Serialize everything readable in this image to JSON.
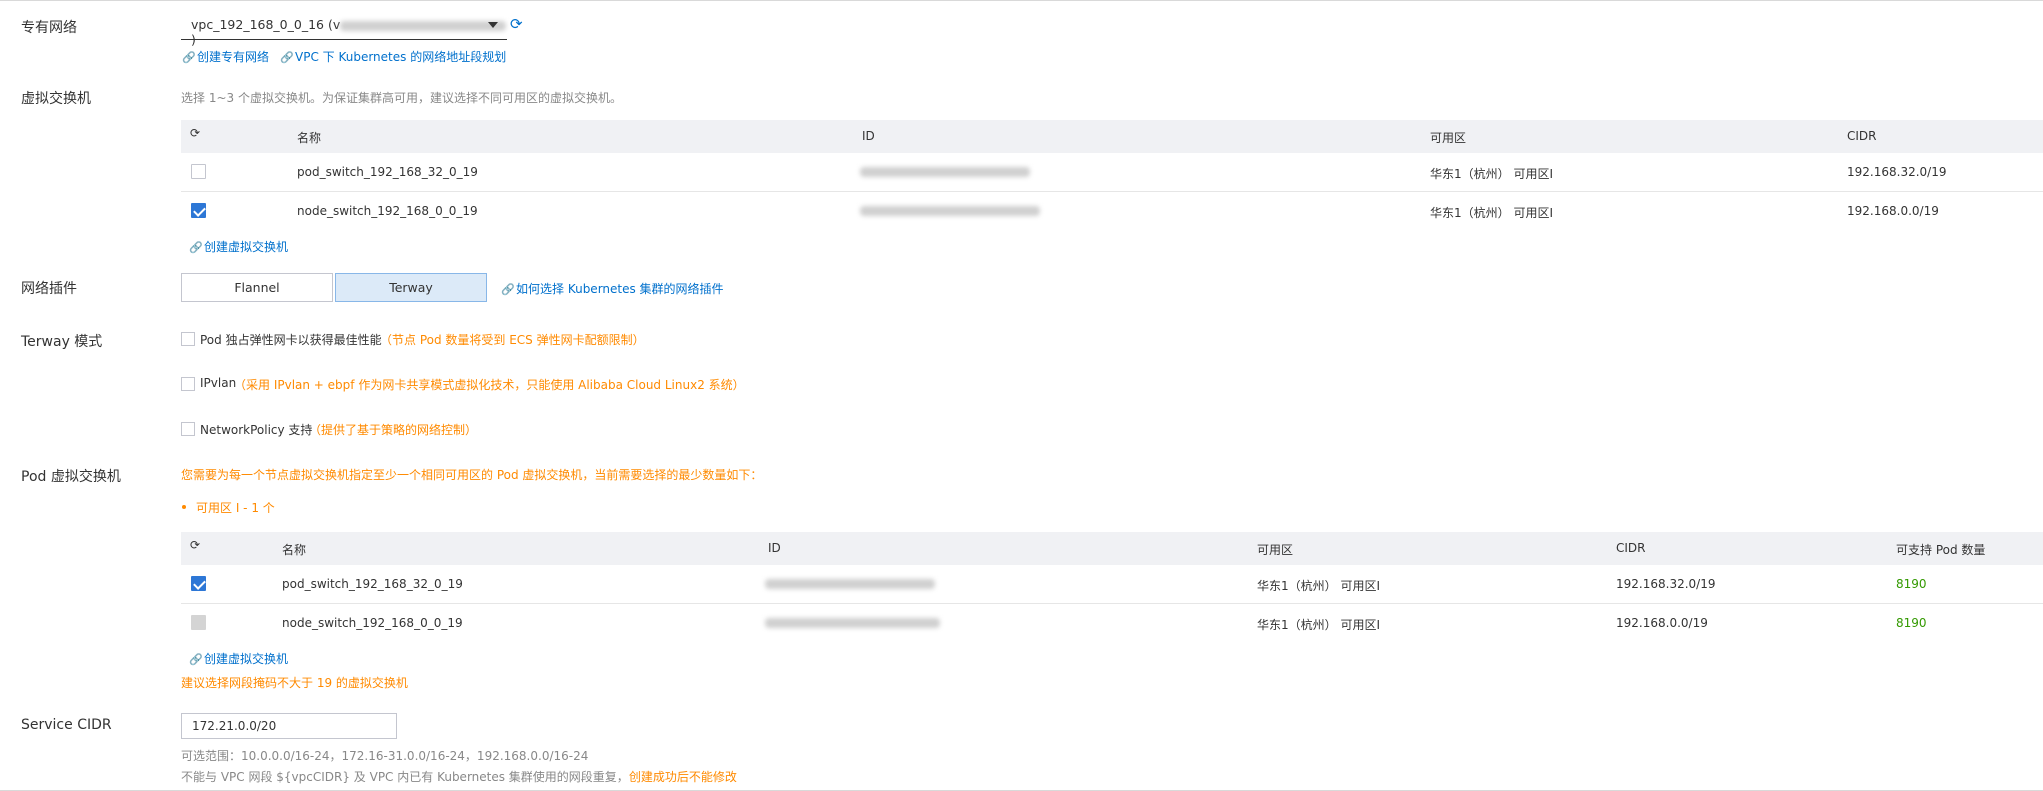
{
  "vpc": {
    "label": "专有网络",
    "select_value": "vpc_192_168_0_0_16 (v",
    "select_suffix": ")",
    "links": [
      "创建专有网络",
      "VPC 下 Kubernetes 的网络地址段规划"
    ]
  },
  "vswitch": {
    "label": "虚拟交换机",
    "hint": "选择 1~3 个虚拟交换机。为保证集群高可用，建议选择不同可用区的虚拟交换机。",
    "columns": [
      "名称",
      "ID",
      "可用区",
      "CIDR"
    ],
    "rows": [
      {
        "name": "pod_switch_192_168_32_0_19",
        "zone": "华东1（杭州） 可用区I",
        "cidr": "192.168.32.0/19",
        "checked": false
      },
      {
        "name": "node_switch_192_168_0_0_19",
        "zone": "华东1（杭州） 可用区I",
        "cidr": "192.168.0.0/19",
        "checked": true
      }
    ],
    "create_link": "创建虚拟交换机"
  },
  "plugin": {
    "label": "网络插件",
    "options": [
      "Flannel",
      "Terway"
    ],
    "selected": "Terway",
    "help_link": "如何选择 Kubernetes 集群的网络插件"
  },
  "terway_mode": {
    "label": "Terway 模式",
    "options": [
      {
        "text": "Pod 独占弹性网卡以获得最佳性能",
        "note": "（节点 Pod 数量将受到 ECS 弹性网卡配额限制）"
      },
      {
        "text": "IPvlan",
        "note": "（采用 IPvlan + ebpf 作为网卡共享模式虚拟化技术，只能使用 Alibaba Cloud Linux2 系统）"
      },
      {
        "text": "NetworkPolicy 支持",
        "note": "（提供了基于策略的网络控制）"
      }
    ]
  },
  "pod_vswitch": {
    "label": "Pod 虚拟交换机",
    "warning": "您需要为每一个节点虚拟交换机指定至少一个相同可用区的 Pod 虚拟交换机，当前需要选择的最少数量如下：",
    "bullet": "可用区 I - 1 个",
    "columns": [
      "名称",
      "ID",
      "可用区",
      "CIDR",
      "可支持 Pod 数量"
    ],
    "rows": [
      {
        "name": "pod_switch_192_168_32_0_19",
        "zone": "华东1（杭州） 可用区I",
        "cidr": "192.168.32.0/19",
        "count": "8190",
        "state": "checked"
      },
      {
        "name": "node_switch_192_168_0_0_19",
        "zone": "华东1（杭州） 可用区I",
        "cidr": "192.168.0.0/19",
        "count": "8190",
        "state": "disabled"
      }
    ],
    "create_link": "创建虚拟交换机",
    "mask_hint": "建议选择网段掩码不大于 19 的虚拟交换机"
  },
  "service_cidr": {
    "label": "Service CIDR",
    "value": "172.21.0.0/20",
    "range_hint": "可选范围：10.0.0.0/16-24，172.16-31.0.0/16-24，192.168.0.0/16-24",
    "conflict_hint": "不能与 VPC 网段 ${vpcCIDR} 及 VPC 内已有 Kubernetes 集群使用的网段重复，",
    "conflict_warn": "创建成功后不能修改"
  },
  "colors": {
    "link": "#0070cc",
    "warning": "#ff8a00",
    "count": "#339900",
    "checkbox": "#2d77d6"
  }
}
